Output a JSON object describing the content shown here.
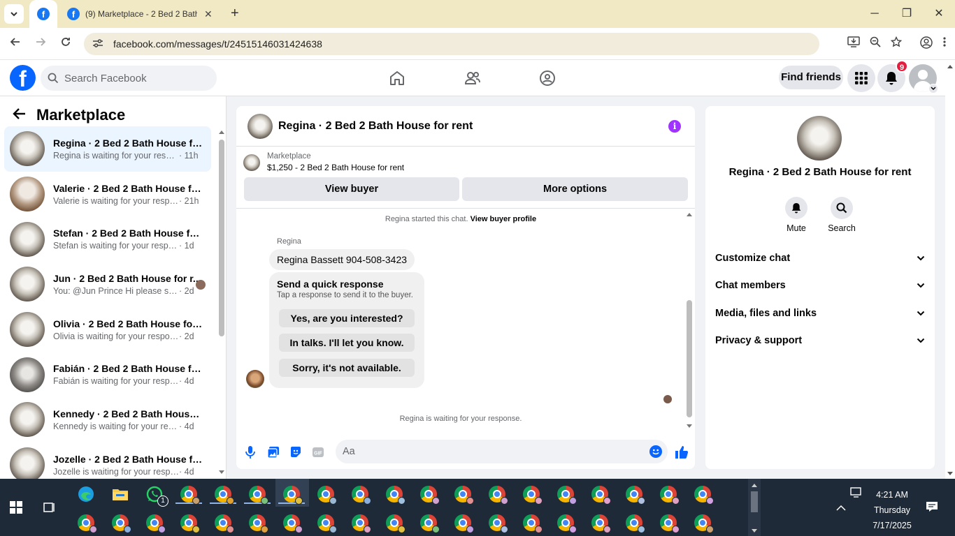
{
  "browser": {
    "tab_title": "(9) Marketplace - 2 Bed 2 Bath House",
    "url": "facebook.com/messages/t/24515146031424638",
    "new_tab": "+",
    "tab_close": "✕",
    "win_min": "─",
    "win_max": "❐",
    "win_close": "✕"
  },
  "facebook": {
    "search_placeholder": "Search Facebook",
    "find_friends": "Find friends",
    "notification_count": "9"
  },
  "left": {
    "title": "Marketplace",
    "conversations": [
      {
        "title": "Regina · 2 Bed 2 Bath House for...",
        "message": "Regina is waiting for your respon...",
        "time": "· 11h",
        "active": true
      },
      {
        "title": "Valerie · 2 Bed 2 Bath House for ...",
        "message": "Valerie is waiting for your response.",
        "time": "· 21h"
      },
      {
        "title": "Stefan · 2 Bed 2 Bath House for ...",
        "message": "Stefan is waiting for your response.",
        "time": "· 1d"
      },
      {
        "title": "Jun · 2 Bed 2 Bath House for r...",
        "message": "You: @Jun Prince Hi please shar...",
        "time": "· 2d"
      },
      {
        "title": "Olivia · 2 Bed 2 Bath House for r...",
        "message": "Olivia is waiting for your response.",
        "time": "· 2d"
      },
      {
        "title": "Fabián · 2 Bed 2 Bath House for ...",
        "message": "Fabián is waiting for your response.",
        "time": "· 4d"
      },
      {
        "title": "Kennedy · 2 Bed 2 Bath House f...",
        "message": "Kennedy is waiting for your respon...",
        "time": "· 4d"
      },
      {
        "title": "Jozelle · 2 Bed 2 Bath House for ...",
        "message": "Jozelle is waiting for your response.",
        "time": "· 4d"
      }
    ]
  },
  "chat": {
    "header_title": "Regina · 2 Bed 2 Bath House for rent",
    "marketplace_label": "Marketplace",
    "listing": "$1,250 - 2 Bed 2 Bath House for rent",
    "view_buyer": "View buyer",
    "more_options": "More options",
    "started_text": "Regina started this chat.",
    "view_buyer_profile": "View buyer profile",
    "sender_name": "Regina",
    "message": "Regina Bassett 904-508-3423",
    "quick_title": "Send a quick response",
    "quick_subtitle": "Tap a response to send it to the buyer.",
    "quick_replies": [
      "Yes, are you interested?",
      "In talks. I'll let you know.",
      "Sorry, it's not available."
    ],
    "waiting_text": "Regina is waiting for your response.",
    "composer_placeholder": "Aa"
  },
  "right": {
    "name": "Regina · 2 Bed 2 Bath House for rent",
    "mute": "Mute",
    "search": "Search",
    "sections": [
      "Customize chat",
      "Chat members",
      "Media, files and links",
      "Privacy & support"
    ]
  },
  "taskbar": {
    "whatsapp_badge": "1",
    "time": "4:21 AM",
    "day": "Thursday",
    "date": "7/17/2025"
  },
  "colors": {
    "fb_blue": "#0866ff",
    "info_purple": "#a033ff",
    "notification_red": "#e41e3f",
    "taskbar": "#1f2a38",
    "tabbar": "#f1e9c4"
  }
}
